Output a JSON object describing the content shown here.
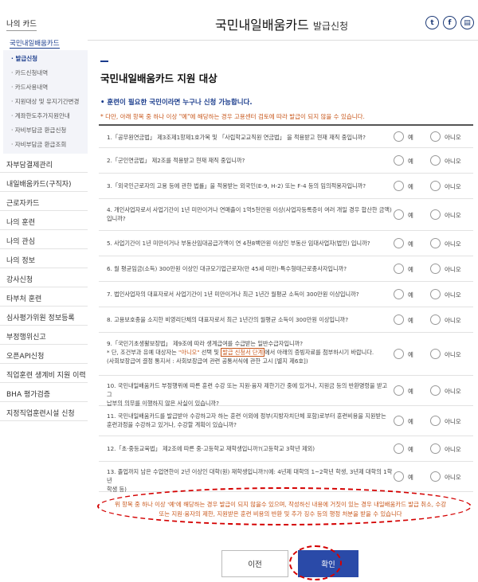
{
  "sidebar": {
    "top_title": "나의 카드",
    "sub_title": "국민내일배움카드",
    "sub_items": [
      "· 발급신청",
      "· 카드신청내역",
      "· 카드사용내역",
      "· 지원대상 및 유지기간변경",
      "· 계좌한도추가지원안내",
      "· 자비부담금 환급신청",
      "· 자비부담금 환급조회"
    ],
    "items": [
      "자부담결제관리",
      "내일배움카드(구직자)",
      "근로자카드",
      "나의 훈련",
      "나의 관심",
      "나의 정보",
      "강사신청",
      "타부처 훈련",
      "심사평가위원 정보등록",
      "부정행위신고",
      "오픈API신청",
      "직업훈련 생계비 지원 이력",
      "BHA 평가검증",
      "지정직업훈련시설 신청"
    ]
  },
  "header": {
    "title": "국민내일배움카드",
    "subtitle": "발급신청",
    "share_twitter": "t",
    "share_facebook": "f",
    "share_print": "▤"
  },
  "section": {
    "title": "국민내일배움카드 지원 대상",
    "bullet": "훈련이 필요한 국민이라면 누구나 신청 가능합니다.",
    "notice": "* 다만, 아래 항목 중 하나 이상 \"예\"에 해당하는 경우 고용센터 검토에 따라 발급이 되지 않을 수 있습니다."
  },
  "radio_labels": {
    "yes": "예",
    "no": "아니오"
  },
  "questions": [
    {
      "lines": [
        "1.「공무원연금법」 제3조제1항제1호가목 및 「사립학교교직원 연금법」 을 적용받고 현재 재직 중입니까?"
      ]
    },
    {
      "lines": [
        "2.「군인연금법」 제2조를 적용받고 현재 재직 중입니까?"
      ]
    },
    {
      "lines": [
        "3.「외국인근로자의 고용 등에 관한 법률」을 적용받는 외국인(E-9, H-2) 또는 F-4 등의 임의적용자입니까?"
      ]
    },
    {
      "lines": [
        "4. 개인사업자로서 사업기간이 1년 미만이거나 연매출이 1억5천만원 이상(사업자등록증이 여러 개일 경우 합산한 금액)",
        "입니까?"
      ]
    },
    {
      "lines": [
        "5. 사업기간이 1년 미만이거나 부동산임대공급가액이 연 4천8백만원 이상인 부동산 임대사업자(법인) 입니까?"
      ]
    },
    {
      "lines": [
        "6. 월 평균임금(소득) 300만원 이상인 대규모기업근로자(만 45세 미만)·특수형태근로종사자입니까?"
      ]
    },
    {
      "lines": [
        "7. 법인사업자의 대표자로서 사업기간이 1년 미만이거나 최근 1년간 월평균 소득이 300만원 이상입니까?"
      ]
    },
    {
      "lines": [
        "8. 고용보호종을 소지한 비영리단체의 대표자로서 최근 1년간의 월평균 소득이 300만원 이상입니까?"
      ]
    },
    {
      "lines": [
        "9.「국민기초생활보장법」 제9조에 따라 생계급여를 수급받는 일반수급자입니까?"
      ],
      "note_prefix": "* 단, 조건부과 유예 대상자는 ",
      "note_red": "\"아니오\"",
      "note_mid": " 선택 및 ",
      "note_box": "발급 신청서 단계",
      "note_suffix": "에서 아래의 증빙자료를 첨부하시기 바랍니다.",
      "note_line2": "(사회보장급여 결정 통지서 : 사회보장급여 관련 공통서식에 관한 고시 [별지 제6호])"
    },
    {
      "lines": [
        "10. 국민내일배움카드 부정행위에 따른 훈련 수강 또는 지원·융자 제한기간 중에 있거나, 지원금 등의 반환명령을 받고 그",
        "납부의 의무를 이행하지 않은 사실이 있습니까?"
      ]
    },
    {
      "lines": [
        "11. 국민내일배움카드를 발급받아 수강하고자 하는 훈련 이외에 정부(지방자치단체 포함)로부터 훈련비용을 지원받는",
        "훈련과정을 수강하고 있거나, 수강할 계획이 있습니까?"
      ]
    },
    {
      "lines": [
        "12.「초·중등교육법」 제2조에 따른 중·고등학교 재학생입니까?(고등학교 3학년 제외)"
      ]
    },
    {
      "lines": [
        "13. 졸업까지 남은 수업연한이 2년 이상인 대학(원) 재학생입니까?(예: 4년제 대학의 1~2학년 학생, 3년제 대학의 1학년",
        "학생 등)"
      ]
    }
  ],
  "warning": {
    "line1": "위 항목 중 하나 이상 '예'에 해당하는 경우 발급이 되지 않을수 있으며, 작성하신 내용에 거짓이 있는 경우 내일배움카드 발급 취소, 수강",
    "line2": "또는 지원·융자의 제한, 지원받은 훈련 비용의 반환 및 추가 징수 등의 행정 처분을 받을 수 있습니다"
  },
  "buttons": {
    "prev": "이전",
    "confirm": "확인"
  },
  "colors": {
    "accent": "#1a3c8c",
    "warning": "#c8571b",
    "confirm_button": "#2a4aa8",
    "annotation": "#d40000"
  }
}
